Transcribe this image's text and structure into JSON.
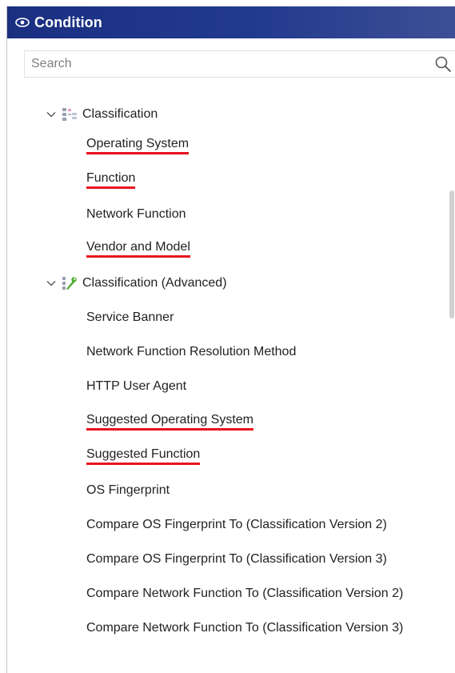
{
  "header": {
    "title": "Condition",
    "icon": "eye-icon"
  },
  "search": {
    "placeholder": "Search"
  },
  "tree": {
    "groups": [
      {
        "label": "Classification",
        "icon": "classification-icon",
        "expanded": true,
        "items": [
          {
            "label": "Operating System",
            "highlighted": true
          },
          {
            "label": "Function",
            "highlighted": true
          },
          {
            "label": "Network Function",
            "highlighted": false
          },
          {
            "label": "Vendor and Model",
            "highlighted": true
          }
        ]
      },
      {
        "label": "Classification (Advanced)",
        "icon": "classification-advanced-icon",
        "expanded": true,
        "items": [
          {
            "label": "Service Banner",
            "highlighted": false
          },
          {
            "label": "Network Function Resolution Method",
            "highlighted": false
          },
          {
            "label": "HTTP User Agent",
            "highlighted": false
          },
          {
            "label": "Suggested Operating System",
            "highlighted": true
          },
          {
            "label": "Suggested Function",
            "highlighted": true
          },
          {
            "label": "OS Fingerprint",
            "highlighted": false
          },
          {
            "label": "Compare OS Fingerprint To (Classification Version 2)",
            "highlighted": false
          },
          {
            "label": "Compare OS Fingerprint To (Classification Version 3)",
            "highlighted": false
          },
          {
            "label": "Compare Network Function To (Classification Version 2)",
            "highlighted": false
          },
          {
            "label": "Compare Network Function To (Classification Version 3)",
            "highlighted": false
          }
        ]
      }
    ]
  },
  "colors": {
    "header_bg": "#1a2f80",
    "underline": "#e8121e"
  }
}
